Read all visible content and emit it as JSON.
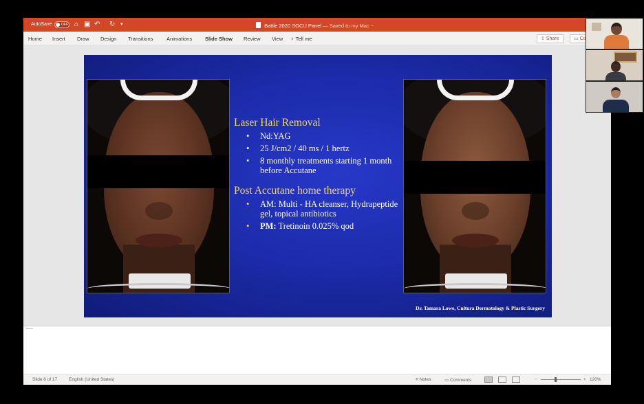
{
  "titlebar": {
    "autosave_label": "AutoSave",
    "autosave_state": "OFF",
    "document_title": "Battle 2020 SOCU Panel",
    "saved_status": "— Saved to my Mac ~"
  },
  "ribbon": {
    "tabs": [
      "Home",
      "Insert",
      "Draw",
      "Design",
      "Transitions",
      "Animations",
      "Slide Show",
      "Review",
      "View"
    ],
    "active_tab": "Slide Show",
    "tell_me": "Tell me",
    "share_label": "Share",
    "comments_label": "Co"
  },
  "slide": {
    "section1": {
      "heading": "Laser Hair Removal",
      "bullets": [
        "Nd:YAG",
        "25 J/cm2 / 40 ms / 1 hertz",
        "8 monthly treatments starting 1 month before Accutane"
      ]
    },
    "section2": {
      "heading": "Post Accutane home therapy",
      "bullet1_prefix": "AM:",
      "bullet1_text": "Multi - HA cleanser, Hydrapeptide gel, topical antibiotics",
      "bullet2_prefix": "PM:",
      "bullet2_text": "Tretinoin 0.025% qod"
    },
    "credit": "Dr. Tamara Lowe, Cultura Dermatology & Plastic Surgery"
  },
  "statusbar": {
    "slide_indicator": "Slide 6 of 17",
    "language": "English (United States)",
    "notes_label": "Notes",
    "comments_label": "Comments",
    "zoom_level": "120%"
  },
  "colors": {
    "titlebar": "#d24726",
    "slide_background": "#1c2cab",
    "heading_yellow": "#f5d76e"
  }
}
